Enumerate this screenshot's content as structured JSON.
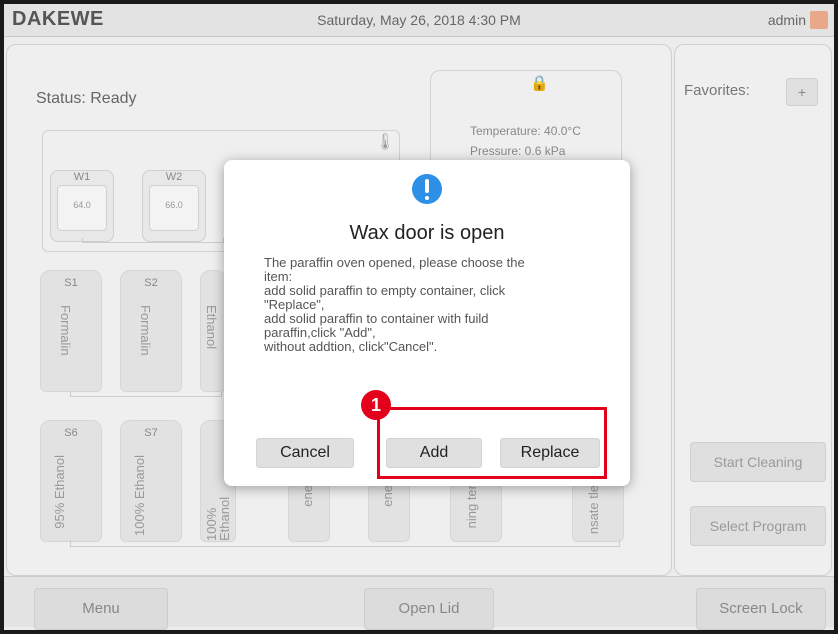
{
  "header": {
    "logo": "DAKEWE",
    "datetime": "Saturday, May 26, 2018  4:30 PM",
    "user": "admin"
  },
  "main": {
    "status": "Status:  Ready",
    "oven": {
      "temperature": "Temperature:  40.0°C",
      "pressure": "Pressure:  0.6 kPa"
    },
    "wax": [
      {
        "label": "W1",
        "value": "64.0"
      },
      {
        "label": "W2",
        "value": "66.0"
      }
    ],
    "bottles_row1": [
      {
        "label": "S1",
        "name": "Formalin"
      },
      {
        "label": "S2",
        "name": "Formalin"
      },
      {
        "label": "",
        "name": "Ethanol"
      }
    ],
    "bottles_row2": [
      {
        "label": "S6",
        "name": "95% Ethanol"
      },
      {
        "label": "S7",
        "name": "100% Ethanol"
      },
      {
        "label": "",
        "name": "100% Ethanol"
      },
      {
        "label": "",
        "name": "ene"
      },
      {
        "label": "",
        "name": "ene"
      },
      {
        "label": "",
        "name": "ning ter"
      },
      {
        "label": "",
        "name": "nsate tle"
      }
    ]
  },
  "side": {
    "favorites_label": "Favorites:",
    "add_label": "+",
    "start_cleaning": "Start Cleaning",
    "select_program": "Select Program"
  },
  "footer": {
    "menu": "Menu",
    "open_lid": "Open Lid",
    "screen_lock": "Screen Lock"
  },
  "dialog": {
    "title": "Wax door is open",
    "message_lines": [
      "The paraffin oven opened, please choose the",
      "item:",
      "add solid paraffin to empty container, click",
      "\"Replace\",",
      "add solid paraffin to container with fuild",
      "paraffin,click \"Add\",",
      "without addtion, click\"Cancel\"."
    ],
    "cancel": "Cancel",
    "add": "Add",
    "replace": "Replace"
  },
  "annotation": {
    "marker": "1"
  },
  "colors": {
    "accent_blue": "#2e8fe6",
    "highlight_red": "#e3001b"
  }
}
